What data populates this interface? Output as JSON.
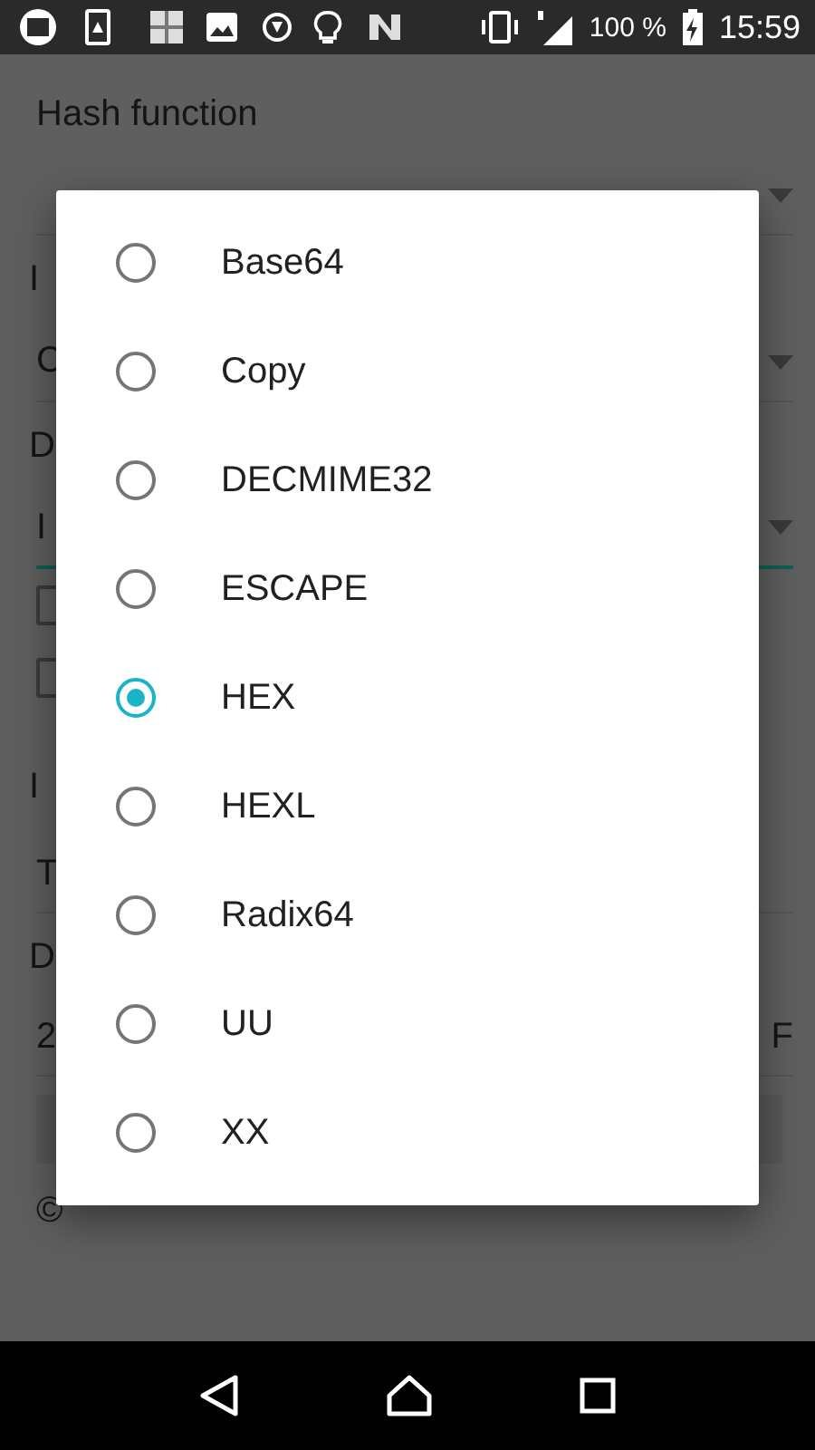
{
  "status_bar": {
    "battery": "100 %",
    "time": "15:59"
  },
  "background": [
    {
      "kind": "label",
      "text": "Hash function"
    },
    {
      "kind": "dropdown",
      "focused": false
    },
    {
      "kind": "label",
      "text": "I"
    },
    {
      "kind": "dropdown",
      "text": "C",
      "focused": false
    },
    {
      "kind": "label",
      "text": "D"
    },
    {
      "kind": "dropdown",
      "text": "I",
      "focused": true
    },
    {
      "kind": "checkbox",
      "checked": false
    },
    {
      "kind": "checkbox",
      "checked": false
    },
    {
      "kind": "label",
      "text": "I"
    },
    {
      "kind": "field",
      "text": "T"
    },
    {
      "kind": "label",
      "text": "D"
    },
    {
      "kind": "field",
      "text": "2",
      "end_text": "F"
    },
    {
      "kind": "button"
    },
    {
      "kind": "footer",
      "text": "©"
    }
  ],
  "dialog": {
    "options": [
      {
        "label": "Base64",
        "selected": false
      },
      {
        "label": "Copy",
        "selected": false
      },
      {
        "label": "DECMIME32",
        "selected": false
      },
      {
        "label": "ESCAPE",
        "selected": false
      },
      {
        "label": "HEX",
        "selected": true
      },
      {
        "label": "HEXL",
        "selected": false
      },
      {
        "label": "Radix64",
        "selected": false
      },
      {
        "label": "UU",
        "selected": false
      },
      {
        "label": "XX",
        "selected": false
      }
    ]
  }
}
